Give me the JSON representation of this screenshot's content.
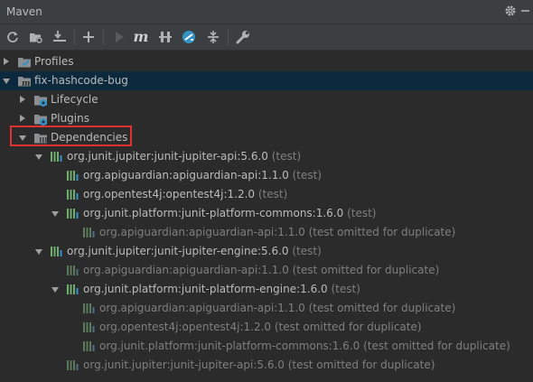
{
  "panel": {
    "title": "Maven"
  },
  "toolbar": {
    "buttons": [
      "reload-icon",
      "generate-sources-icon",
      "download-icon",
      "add-icon",
      "run-icon",
      "execute-goal-icon",
      "toggle-offline-icon",
      "skip-tests-icon",
      "show-dependencies-icon",
      "settings-wrench-icon"
    ]
  },
  "tree": {
    "profiles": "Profiles",
    "project": "fix-hashcode-bug",
    "lifecycle": "Lifecycle",
    "plugins": "Plugins",
    "dependencies": "Dependencies",
    "deps": [
      {
        "label": "org.junit.jupiter:junit-jupiter-api:5.6.0",
        "suffix": " (test)"
      },
      {
        "label": "org.apiguardian:apiguardian-api:1.1.0",
        "suffix": " (test)"
      },
      {
        "label": "org.opentest4j:opentest4j:1.2.0",
        "suffix": " (test)"
      },
      {
        "label": "org.junit.platform:junit-platform-commons:1.6.0",
        "suffix": " (test)"
      },
      {
        "label": "org.apiguardian:apiguardian-api:1.1.0",
        "suffix": " (test omitted for duplicate)"
      },
      {
        "label": "org.junit.jupiter:junit-jupiter-engine:5.6.0",
        "suffix": " (test)"
      },
      {
        "label": "org.apiguardian:apiguardian-api:1.1.0",
        "suffix": " (test omitted for duplicate)"
      },
      {
        "label": "org.junit.platform:junit-platform-engine:1.6.0",
        "suffix": " (test)"
      },
      {
        "label": "org.apiguardian:apiguardian-api:1.1.0",
        "suffix": " (test omitted for duplicate)"
      },
      {
        "label": "org.opentest4j:opentest4j:1.2.0",
        "suffix": " (test omitted for duplicate)"
      },
      {
        "label": "org.junit.platform:junit-platform-commons:1.6.0",
        "suffix": " (test omitted for duplicate)"
      },
      {
        "label": "org.junit.jupiter:junit-jupiter-api:5.6.0",
        "suffix": " (test omitted for duplicate)"
      }
    ]
  },
  "colors": {
    "selection": "#0d293e",
    "highlight_box": "#e03131",
    "accent_blue": "#3592c4"
  }
}
